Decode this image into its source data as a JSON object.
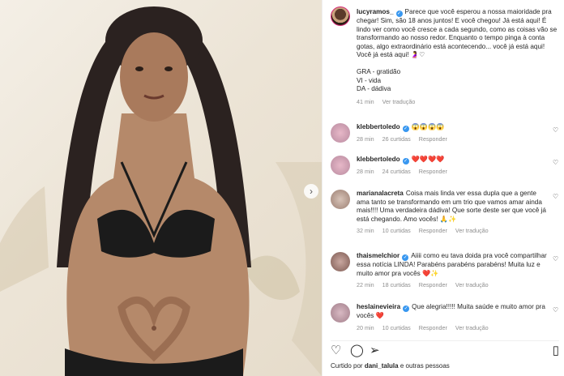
{
  "post": {
    "username": "lucyramos_",
    "caption": "Parece que você esperou a nossa maioridade pra chegar! Sim, são 18 anos juntos! E você chegou! Já está aqui! É lindo ver como você cresce a cada segundo, como as coisas vão se transformando ao nosso redor. Enquanto o tempo pinga à conta gotas, algo extraordinário está acontecendo... você já está aqui! Você já está aqui! 🤰♡",
    "gra": "GRA - gratidão",
    "vi": "VI - vida",
    "da": "DA - dádiva",
    "time": "41 min",
    "translate": "Ver tradução"
  },
  "comments": [
    {
      "username": "klebbertoledo",
      "text": "😱😱😱😱",
      "time": "28 min",
      "likes": "26 curtidas",
      "reply": "Responder",
      "translate": ""
    },
    {
      "username": "klebbertoledo",
      "text": "❤️❤️❤️❤️",
      "time": "28 min",
      "likes": "24 curtidas",
      "reply": "Responder",
      "translate": ""
    },
    {
      "username": "marianalacreta",
      "text": "Coisa mais linda ver essa dupla que a gente ama tanto se transformando em um trio que vamos amar ainda mais!!!! Uma verdadeira dádiva! Que sorte deste ser que você já está chegando. Amo vocês! 🙏✨",
      "time": "32 min",
      "likes": "10 curtidas",
      "reply": "Responder",
      "translate": "Ver tradução"
    },
    {
      "username": "thaismelchior",
      "text": "Aiiii como eu tava doida pra você compartilhar essa notícia LINDA! Parabéns parabéns parabéns! Muita luz e muito amor pra vocês ❤️✨",
      "time": "22 min",
      "likes": "18 curtidas",
      "reply": "Responder",
      "translate": "Ver tradução"
    },
    {
      "username": "heslainevieira",
      "text": "Que alegria!!!!! Muita saúde e muito amor pra vocês ❤️",
      "time": "20 min",
      "likes": "10 curtidas",
      "reply": "Responder",
      "translate": "Ver tradução"
    }
  ],
  "footer": {
    "liked_by_prefix": "Curtido por",
    "liked_by_user": "dani_talula",
    "liked_by_suffix": "e outras pessoas"
  },
  "icons": {
    "like": "heart-icon",
    "comment": "comment-icon",
    "share": "share-icon",
    "save": "bookmark-icon",
    "next": "chevron-right-icon"
  },
  "colors": {
    "verified": "#3897f0",
    "meta": "#8e8e8e",
    "text": "#262626"
  }
}
